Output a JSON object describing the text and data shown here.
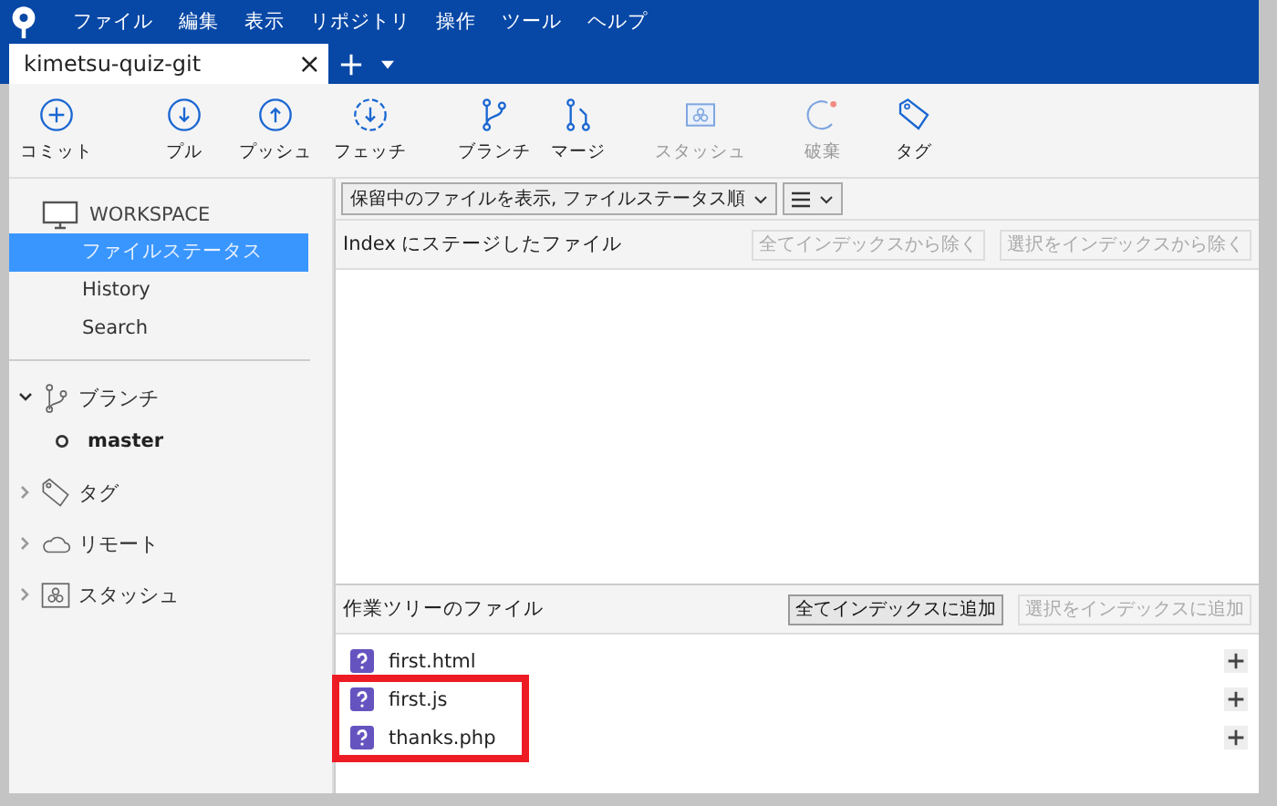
{
  "menu": [
    "ファイル",
    "編集",
    "表示",
    "リポジトリ",
    "操作",
    "ツール",
    "ヘルプ"
  ],
  "tabs": [
    {
      "label": "kimetsu-quiz-git",
      "selected": true,
      "close": "×"
    }
  ],
  "toolbar": [
    {
      "kind": "commit",
      "label": "コミット",
      "disabled": false
    },
    {
      "kind": "pull",
      "label": "プル",
      "disabled": false
    },
    {
      "kind": "push",
      "label": "プッシュ",
      "disabled": false
    },
    {
      "kind": "fetch",
      "label": "フェッチ",
      "disabled": false
    },
    {
      "kind": "branch",
      "label": "ブランチ",
      "disabled": false
    },
    {
      "kind": "merge",
      "label": "マージ",
      "disabled": false
    },
    {
      "kind": "stash",
      "label": "スタッシュ",
      "disabled": true
    },
    {
      "kind": "discard",
      "label": "破棄",
      "disabled": true
    },
    {
      "kind": "tag",
      "label": "タグ",
      "disabled": false
    }
  ],
  "sidebar": {
    "workspace": {
      "title": "WORKSPACE",
      "items": [
        {
          "label": "ファイルステータス",
          "selected": true
        },
        {
          "label": "History",
          "selected": false
        },
        {
          "label": "Search",
          "selected": false
        }
      ]
    },
    "sections": [
      {
        "kind": "branch",
        "label": "ブランチ",
        "expanded": true,
        "children": [
          {
            "label": "master",
            "current": true
          }
        ]
      },
      {
        "kind": "tag",
        "label": "タグ",
        "expanded": false
      },
      {
        "kind": "remote",
        "label": "リモート",
        "expanded": false
      },
      {
        "kind": "stash",
        "label": "スタッシュ",
        "expanded": false
      }
    ]
  },
  "filter": {
    "sort": "保留中のファイルを表示, ファイルステータス順"
  },
  "staged": {
    "title": "Index にステージしたファイル",
    "buttons": [
      {
        "label": "全てインデックスから除く",
        "disabled": true
      },
      {
        "label": "選択をインデックスから除く",
        "disabled": true
      }
    ]
  },
  "working": {
    "title": "作業ツリーのファイル",
    "buttons": [
      {
        "label": "全てインデックスに追加",
        "disabled": false
      },
      {
        "label": "選択をインデックスに追加",
        "disabled": true
      }
    ],
    "files": [
      {
        "name": "first.html",
        "highlighted": false
      },
      {
        "name": "first.js",
        "highlighted": true
      },
      {
        "name": "thanks.php",
        "highlighted": true
      }
    ]
  }
}
